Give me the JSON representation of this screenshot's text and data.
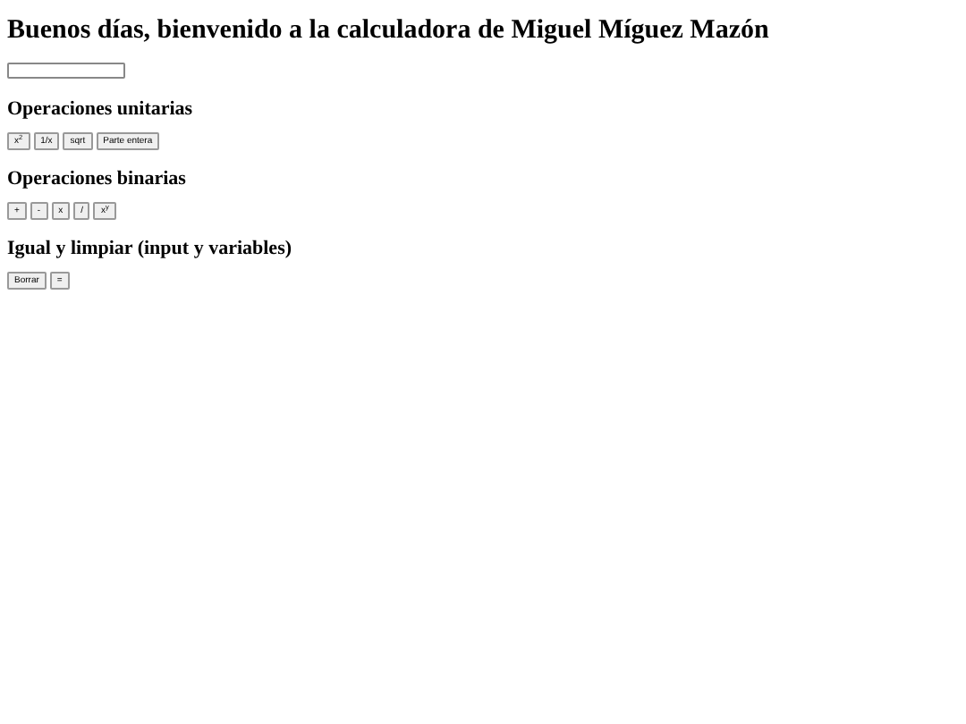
{
  "title": "Buenos días, bienvenido a la calculadora de Miguel Míguez Mazón",
  "sections": [
    {
      "heading": "Operaciones unitarias",
      "buttons": [
        "x$^{2}$",
        "1/x",
        "sqrt",
        "Parte entera"
      ]
    },
    {
      "heading": "Operaciones binarias",
      "buttons": [
        "+",
        "-",
        "x",
        "/",
        "x$^{y}$"
      ]
    },
    {
      "heading": "Igual y limpiar (input y variables)",
      "buttons": [
        "Borrar",
        "="
      ]
    }
  ]
}
